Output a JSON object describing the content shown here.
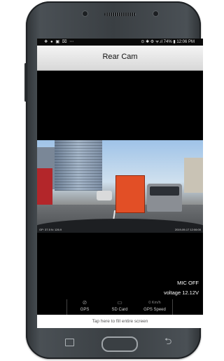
{
  "status_bar": {
    "left_icons": "❖ ● ▣ ⌧ ⋯",
    "right_text": "⊙ ✱ ⚙ ᯤ.ıl 74% ▮ 12:06 PM"
  },
  "app": {
    "title": "Rear Cam"
  },
  "video": {
    "overlay_left": "GP: 37.5  N: 126.9",
    "overlay_right": "2019-09-17  12:06:00"
  },
  "status": {
    "mic": "MIC OFF",
    "voltage": "voltage 12.12V"
  },
  "info": {
    "gps_label": "GPS",
    "sd_label": "SD Card",
    "speed_value": "0 Km/h",
    "speed_label": "GPS Speed",
    "gps_icon": "satellite-icon",
    "sd_icon": "sd-card-icon"
  },
  "fill_screen": {
    "label": "Tap here to fill entire screen"
  },
  "colors": {
    "app_bar": "#e6e6e6",
    "screen_bg": "#000000",
    "fill_bar": "#ffffff"
  }
}
